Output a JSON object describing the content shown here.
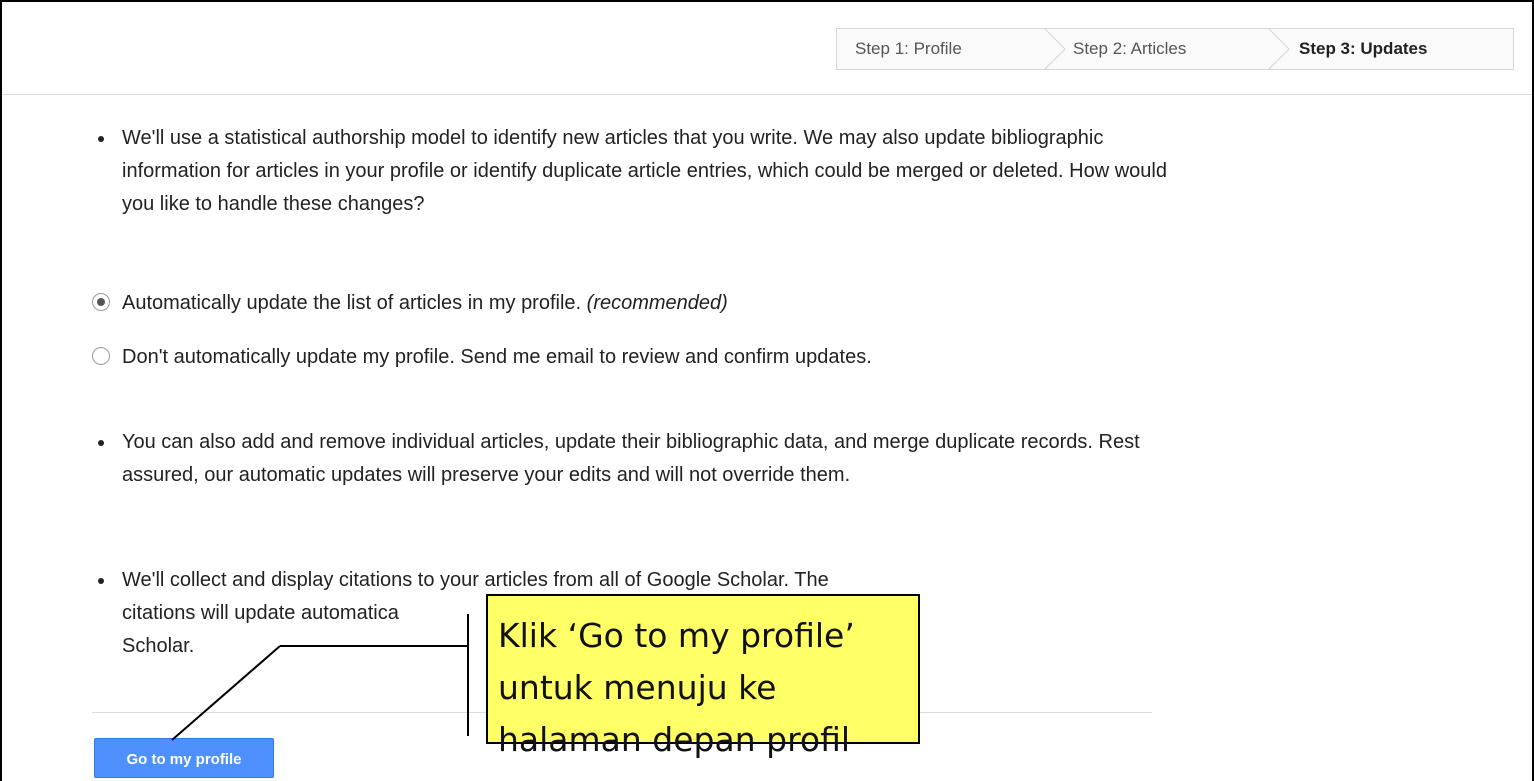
{
  "steps": {
    "step1": "Step 1: Profile",
    "step2": "Step 2: Articles",
    "step3": "Step 3: Updates"
  },
  "content": {
    "bullet1": "We'll use a statistical authorship model to identify new articles that you write. We may also update bibliographic information for articles in your profile or identify duplicate article entries, which could be merged or deleted. How would you like to handle these changes?",
    "option_auto": "Automatically update the list of articles in my profile.",
    "option_auto_note": "(recommended)",
    "option_manual": "Don't automatically update my profile. Send me email to review and confirm updates.",
    "bullet2": "You can also add and remove individual articles, update their bibliographic data, and merge duplicate records. Rest assured, our automatic updates will preserve your edits and will not override them.",
    "bullet3_line1": "We'll collect and display citations to your articles from all of Google Scholar. The",
    "bullet3_line2": "citations will update automatica",
    "bullet3_line3": "Scholar."
  },
  "action": {
    "go_label": "Go to my profile"
  },
  "annotation": {
    "text": "Klik ‘Go to my profile’ untuk menuju ke halaman depan profil",
    "highlight_color": "#ffff66"
  },
  "colors": {
    "button_blue": "#4d90fe",
    "text": "#222222"
  }
}
